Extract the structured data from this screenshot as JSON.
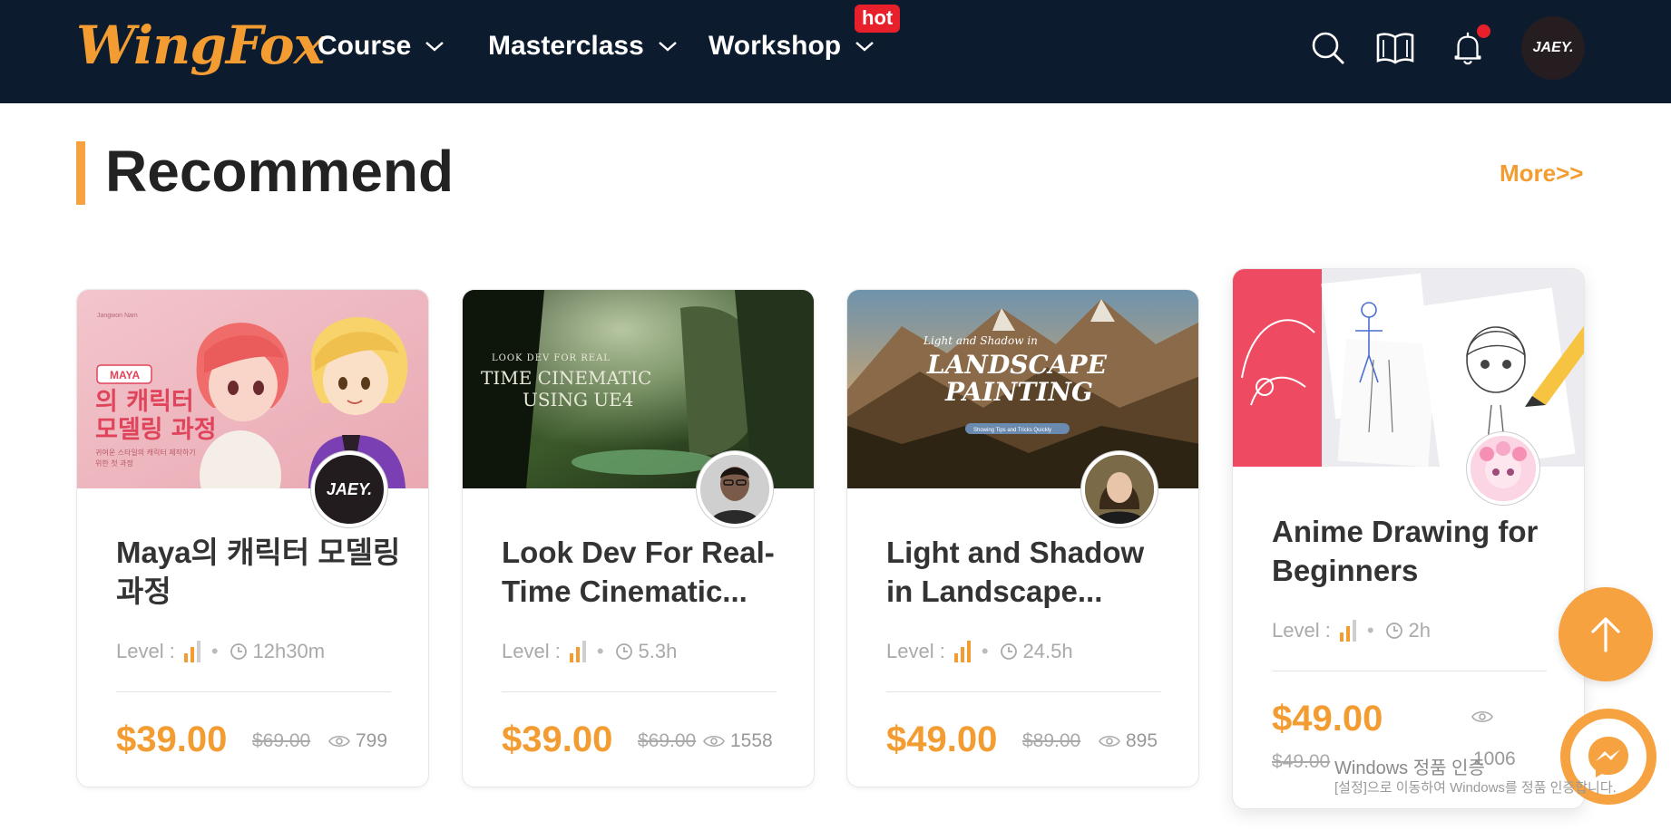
{
  "nav": {
    "logo": "WingFox",
    "menus": [
      "Course",
      "Masterclass",
      "Workshop"
    ],
    "hot_badge": "hot",
    "avatar_text": "JAEY."
  },
  "section": {
    "title": "Recommend",
    "more": "More>>"
  },
  "cards": [
    {
      "title": "Maya의 캐릭터 모델링 과정",
      "level_label": "Level :",
      "duration": "12h30m",
      "price": "$39.00",
      "old_price": "$69.00",
      "views": "799",
      "thumb": {
        "author": "Jangwon Nam",
        "badge": "MAYA",
        "line1": "의 캐릭터",
        "line2": "모델링 과정",
        "sub1": "귀여운 스타일의 캐릭터 제작하기",
        "sub2": "위한 첫 과정"
      },
      "avatar_text": "JAEY."
    },
    {
      "title": "Look Dev For Real-Time Cinematic...",
      "level_label": "Level :",
      "duration": "5.3h",
      "price": "$39.00",
      "old_price": "$69.00",
      "views": "1558",
      "thumb": {
        "pre": "LOOK DEV FOR REAL",
        "line1": "TIME CINEMATIC",
        "line2": "USING UE4"
      }
    },
    {
      "title": "Light and Shadow in Landscape...",
      "level_label": "Level :",
      "duration": "24.5h",
      "price": "$49.00",
      "old_price": "$89.00",
      "views": "895",
      "thumb": {
        "pre": "Light and Shadow in",
        "line1": "LANDSCAPE",
        "line2": "PAINTING",
        "pill": "Showing Tips and Tricks Quickly"
      }
    },
    {
      "title": "Anime Drawing for Beginners",
      "level_label": "Level :",
      "duration": "2h",
      "price": "$49.00",
      "old_price": "$49.00",
      "views": "1006"
    }
  ],
  "watermark": {
    "line1": "Windows 정품 인증",
    "line2": "[설정]으로 이동하여 Windows를 정품 인증합니다."
  },
  "colors": {
    "accent": "#f39c31",
    "nav_bg": "#0d1b2e",
    "hot": "#e8202b"
  },
  "icons": [
    "search-icon",
    "book-icon",
    "bell-icon",
    "clock-icon",
    "eye-icon",
    "arrow-up-icon",
    "messenger-icon",
    "level-bars-icon"
  ]
}
